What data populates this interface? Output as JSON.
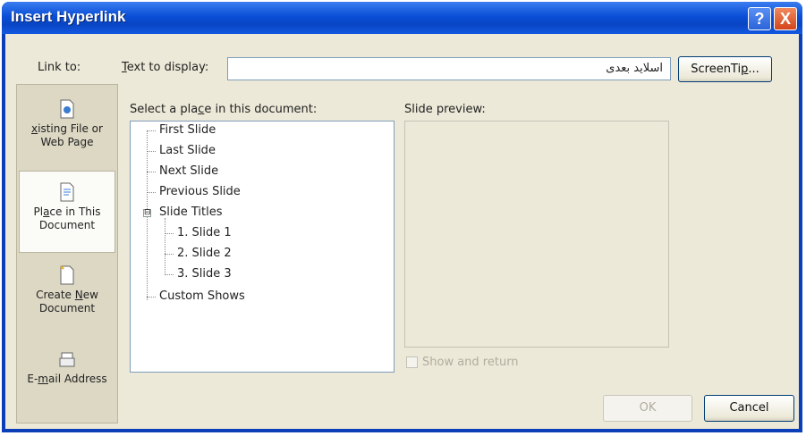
{
  "window": {
    "title": "Insert Hyperlink",
    "help_label": "?",
    "close_label": "X"
  },
  "link_to": {
    "label": "Link to:",
    "items": [
      {
        "label_pre": "",
        "label_ul": "x",
        "label_post": "isting File or",
        "label2": "Web Page",
        "icon": "file-icon"
      },
      {
        "label_pre": "Pl",
        "label_ul": "a",
        "label_post": "ce in This",
        "label2": "Document",
        "icon": "document-place-icon"
      },
      {
        "label_pre": "Create ",
        "label_ul": "N",
        "label_post": "ew",
        "label2": "Document",
        "icon": "new-document-icon"
      },
      {
        "label_pre": "E-",
        "label_ul": "m",
        "label_post": "ail Address",
        "label2": "",
        "icon": "email-icon"
      }
    ]
  },
  "text_to_display": {
    "label_ul": "T",
    "label_rest": "ext to display:",
    "value": "اسلاید بعدی"
  },
  "screentip": {
    "label_pre": "ScreenTi",
    "label_ul": "p",
    "label_post": "..."
  },
  "place": {
    "label_pre": "Select a pla",
    "label_ul": "c",
    "label_post": "e in this document:",
    "tree": [
      "First Slide",
      "Last Slide",
      "Next Slide",
      "Previous Slide",
      "Slide Titles",
      "1. Slide 1",
      "2. Slide 2",
      "3. Slide 3",
      "Custom Shows"
    ],
    "expander": "⊟"
  },
  "preview": {
    "label": "Slide preview:",
    "show_and_return": "Show and return"
  },
  "buttons": {
    "ok": "OK",
    "cancel": "Cancel"
  }
}
